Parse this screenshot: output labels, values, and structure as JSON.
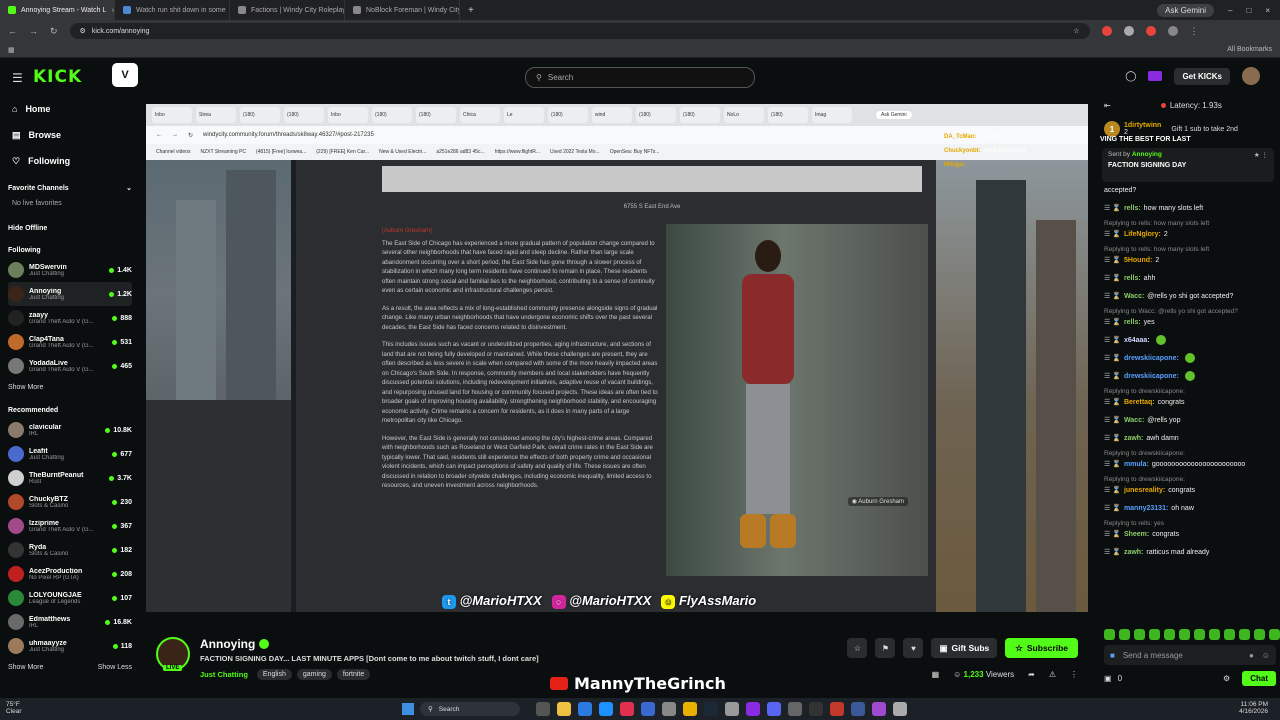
{
  "browser": {
    "tabs": [
      {
        "title": "Annoying Stream - Watch L",
        "color": "#53fc18",
        "active": true
      },
      {
        "title": "Watch run shit down in some",
        "color": "#4a8ad4",
        "active": false
      },
      {
        "title": "Factions | Windy City Roleplay",
        "color": "#888888",
        "active": false
      },
      {
        "title": "NoBlock Foreman | Windy City",
        "color": "#888888",
        "active": false
      }
    ],
    "new_tab": "+",
    "ask_gemini": "Ask Gemini",
    "url": "kick.com/annoying",
    "all_bookmarks": "All Bookmarks"
  },
  "header": {
    "logo": "KICK",
    "search_placeholder": "Search",
    "get_kicks": "Get KICKs"
  },
  "sidebar": {
    "nav": [
      {
        "label": "Home",
        "icon": "home-icon"
      },
      {
        "label": "Browse",
        "icon": "browse-icon"
      },
      {
        "label": "Following",
        "icon": "heart-icon"
      }
    ],
    "favorite_title": "Favorite Channels",
    "no_favorites": "No live favorites",
    "hide_offline": "Hide Offline",
    "following_title": "Following",
    "following": [
      {
        "name": "MDSwervin",
        "game": "Just Chatting",
        "viewers": "1.4K",
        "color": "#6b7f5a"
      },
      {
        "name": "Annoying",
        "game": "Just Chatting",
        "viewers": "1.2K",
        "color": "#3a2418"
      },
      {
        "name": "zaayy",
        "game": "Grand Theft Auto V (G...",
        "viewers": "888",
        "color": "#222222"
      },
      {
        "name": "Clap4Tana",
        "game": "Grand Theft Auto V (G...",
        "viewers": "531",
        "color": "#c06a2a"
      },
      {
        "name": "YodadaLive",
        "game": "Grand Theft Auto V (G...",
        "viewers": "465",
        "color": "#777777"
      }
    ],
    "show_more": "Show More",
    "recommended_title": "Recommended",
    "recommended": [
      {
        "name": "clavicular",
        "game": "IRL",
        "viewers": "10.8K",
        "color": "#8a7a6a"
      },
      {
        "name": "Leafit",
        "game": "Just Chatting",
        "viewers": "677",
        "color": "#4a6ad0"
      },
      {
        "name": "TheBurntPeanut",
        "game": "Rust",
        "viewers": "3.7K",
        "color": "#d0d0d0"
      },
      {
        "name": "ChuckyBTZ",
        "game": "Slots & Casino",
        "viewers": "230",
        "color": "#b04a2a"
      },
      {
        "name": "Izziprime",
        "game": "Grand Theft Auto V (G...",
        "viewers": "367",
        "color": "#a04a8a"
      },
      {
        "name": "Ryda",
        "game": "Slots & Casino",
        "viewers": "182",
        "color": "#333333"
      },
      {
        "name": "AcezProduction",
        "game": "No Pixel RP (GTA)",
        "viewers": "208",
        "color": "#c02020"
      },
      {
        "name": "LOLYOUNGJAE",
        "game": "League of Legends",
        "viewers": "107",
        "color": "#2a8a3a"
      },
      {
        "name": "Edmatthews",
        "game": "IRL",
        "viewers": "16.8K",
        "color": "#6a6a6a"
      },
      {
        "name": "uhmaayyze",
        "game": "Just Chatting",
        "viewers": "118",
        "color": "#9a7a5a"
      }
    ],
    "show_more_2": "Show More",
    "show_less": "Show Less"
  },
  "stream_browser": {
    "ask_gemini": "Ask Gemini",
    "url": "windycity.community.forum/threads/sk8way.46327/#post-217235",
    "bookmarks": [
      "Channel videos",
      "NZXT Streaming PC",
      "(4815) [Free] Icewea...",
      "(229) [FREE] Ken Car...",
      "New & Used Electri...",
      "a251e286 ad83 45c...",
      "https://www.flightR...",
      "Used 2022 Tesla Mo...",
      "OpenSea: Buy NFTs..."
    ]
  },
  "forum": {
    "address": "6755 S East End Ave",
    "red_heading": "[Auburn Gresham]",
    "paragraphs": [
      "The East Side of Chicago has experienced a more gradual pattern of population change compared to several other neighborhoods that have faced rapid and steep decline. Rather than large scale abandonment occurring over a short period, the East Side has gone through a slower process of stabilization in which many long term residents have continued to remain in place. These residents often maintain strong social and familial ties to the neighborhood, contributing to a sense of continuity even as certain economic and infrastructural challenges persist.",
      "As a result, the area reflects a mix of long-established community presence alongside signs of gradual change. Like many urban neighborhoods that have undergone economic shifts over the past several decades, the East Side has faced concerns related to disinvestment.",
      "This includes issues such as vacant or underutilized properties, aging infrastructure, and sections of land that are not being fully developed or maintained. While these challenges are present, they are often described as less severe in scale when compared with some of the more heavily impacted areas on Chicago's South Side. In response, community members and local stakeholders have frequently discussed potential solutions, including redevelopment initiatives, adaptive reuse of vacant buildings, and repurposing unused land for housing or community focused projects. These ideas are often tied to broader goals of improving housing availability, strengthening neighborhood stability, and encouraging economic activity. Crime remains a concern for residents, as it does in many parts of a large metropolitan city like Chicago.",
      "However, the East Side is generally not considered among the city's highest-crime areas. Compared with neighborhoods such as Roseland or West Garfield Park, overall crime rates in the East Side are typically lower. That said, residents still experience the effects of both property crime and occasional violent incidents, which can impact perceptions of safety and quality of life. These issues are often discussed in relation to broader citywide challenges, including economic inequality, limited access to resources, and uneven investment across neighborhoods."
    ],
    "photo_caption": "Auburn Gresham"
  },
  "overlay_chat": [
    {
      "user": "DA_TcMan:",
      "text": "oh shittt"
    },
    {
      "user": "Chuckyonbt:",
      "text": "what happened"
    },
    {
      "user": "Mibiga:",
      "text": ""
    }
  ],
  "socials": {
    "twitter": "@MarioHTXX",
    "instagram": "@MarioHTXX",
    "snapchat": "FlyAssMario"
  },
  "stream": {
    "name": "Annoying",
    "live": "LIVE",
    "title": "FACTION SIGNING DAY... LAST MINUTE APPS  [Dont come to me about twitch stuff, I dont care]",
    "category": "Just Chatting",
    "tags": [
      "English",
      "gaming",
      "fortnite"
    ],
    "gift_subs": "Gift Subs",
    "subscribe": "Subscribe",
    "viewers": "1,233",
    "viewers_label": "Viewers"
  },
  "overlay_bottom": "MannyTheGrinch",
  "chat": {
    "latency": "Latency: 1.93s",
    "gifter_rank": "1",
    "gifter_name": "1dirtytwinn",
    "gifter_count": "2",
    "gift_text": "Gift 1 sub to take 2nd",
    "banner": "VING THE BEST FOR LAST",
    "pinned_by_label": "Sent by",
    "pinned_by": "Annoying",
    "pinned_msg": "FACTION SIGNING DAY",
    "messages": [
      {
        "reply": "",
        "user": "",
        "color": "#eeeeee",
        "text": "accepted?"
      },
      {
        "reply": "",
        "user": "rells:",
        "color": "#8ecb6a",
        "text": "how many slots left"
      },
      {
        "reply": "Replying to rells: how many slots left",
        "user": "LifeNglory:",
        "color": "#e6a800",
        "text": "2"
      },
      {
        "reply": "Replying to rells: how many slots left",
        "user": "5Hound:",
        "color": "#e6a800",
        "text": "2"
      },
      {
        "reply": "",
        "user": "rells:",
        "color": "#8ecb6a",
        "text": "ahh"
      },
      {
        "reply": "",
        "user": "Wacc:",
        "color": "#8ecb6a",
        "text": "@rells yo shi got accepted?"
      },
      {
        "reply": "Replying to Wacc: @rells yo shi got accepted?",
        "user": "rells:",
        "color": "#8ecb6a",
        "text": "yes"
      },
      {
        "reply": "",
        "user": "x64aaa:",
        "color": "#cfd6ff",
        "text": ""
      },
      {
        "reply": "",
        "user": "drewskiicapone:",
        "color": "#5aa0ff",
        "text": ""
      },
      {
        "reply": "",
        "user": "drewskiicapone:",
        "color": "#5aa0ff",
        "text": ""
      },
      {
        "reply": "Replying to drewskiicapone:",
        "user": "Berettaq:",
        "color": "#e6a800",
        "text": "congrats"
      },
      {
        "reply": "",
        "user": "Wacc:",
        "color": "#8ecb6a",
        "text": "@rells yop"
      },
      {
        "reply": "",
        "user": "zawh:",
        "color": "#8ecb6a",
        "text": "awh damn"
      },
      {
        "reply": "Replying to drewskiicapone:",
        "user": "mmula:",
        "color": "#5aa0ff",
        "text": "gooooooooooooooooooooooo"
      },
      {
        "reply": "Replying to drewskiicapone:",
        "user": "junesreality:",
        "color": "#e6a800",
        "text": "congrats"
      },
      {
        "reply": "",
        "user": "manny23131:",
        "color": "#5aa0ff",
        "text": "oh naw"
      },
      {
        "reply": "Replying to rells: yes",
        "user": "Sheem:",
        "color": "#8ecb6a",
        "text": "congrats"
      },
      {
        "reply": "",
        "user": "zawh:",
        "color": "#8ecb6a",
        "text": "ratticus mad already"
      }
    ],
    "send_placeholder": "Send a message",
    "kicks": "0",
    "chat_button": "Chat"
  },
  "taskbar": {
    "temp": "75°F",
    "weather": "Clear",
    "search": "Search",
    "time": "11:06 PM",
    "date": "4/16/2026"
  }
}
